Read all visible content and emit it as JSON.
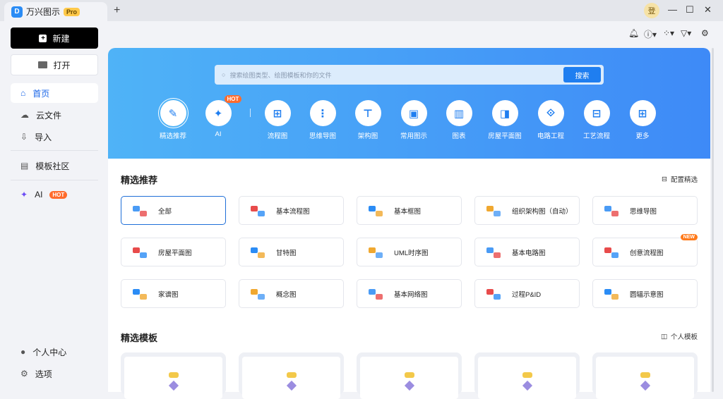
{
  "app": {
    "name": "万兴图示",
    "badge": "Pro",
    "avatar_text": "登"
  },
  "sidebar": {
    "new_label": "新建",
    "open_label": "打开",
    "items": [
      {
        "label": "首页"
      },
      {
        "label": "云文件"
      },
      {
        "label": "导入"
      },
      {
        "label": "模板社区"
      },
      {
        "label": "AI",
        "badge": "HOT"
      }
    ],
    "bottom": [
      {
        "label": "个人中心"
      },
      {
        "label": "选项"
      }
    ]
  },
  "search": {
    "placeholder": "搜索绘图类型、绘图模板和你的文件",
    "button": "搜索"
  },
  "categories": [
    {
      "label": "精选推荐"
    },
    {
      "label": "AI",
      "badge": "HOT"
    },
    {
      "label": "流程图"
    },
    {
      "label": "思维导图"
    },
    {
      "label": "架构图"
    },
    {
      "label": "常用图示"
    },
    {
      "label": "图表"
    },
    {
      "label": "房屋平面图"
    },
    {
      "label": "电路工程"
    },
    {
      "label": "工艺流程"
    },
    {
      "label": "更多"
    }
  ],
  "featured": {
    "title": "精选推荐",
    "config_label": "配置精选",
    "cards": [
      {
        "label": "全部"
      },
      {
        "label": "基本流程图"
      },
      {
        "label": "基本框图"
      },
      {
        "label": "组织架构图（自动）"
      },
      {
        "label": "思维导图"
      },
      {
        "label": "房屋平面图"
      },
      {
        "label": "甘特图"
      },
      {
        "label": "UML时序图"
      },
      {
        "label": "基本电路图"
      },
      {
        "label": "创意流程图",
        "badge": "NEW"
      },
      {
        "label": "家谱图"
      },
      {
        "label": "概念图"
      },
      {
        "label": "基本网络图"
      },
      {
        "label": "过程P&ID"
      },
      {
        "label": "圆辐示意图"
      }
    ]
  },
  "templates": {
    "title": "精选模板",
    "personal_label": "个人模板"
  },
  "colors": {
    "accent": "#1f7ef0",
    "hot": "#ff6b2c"
  }
}
